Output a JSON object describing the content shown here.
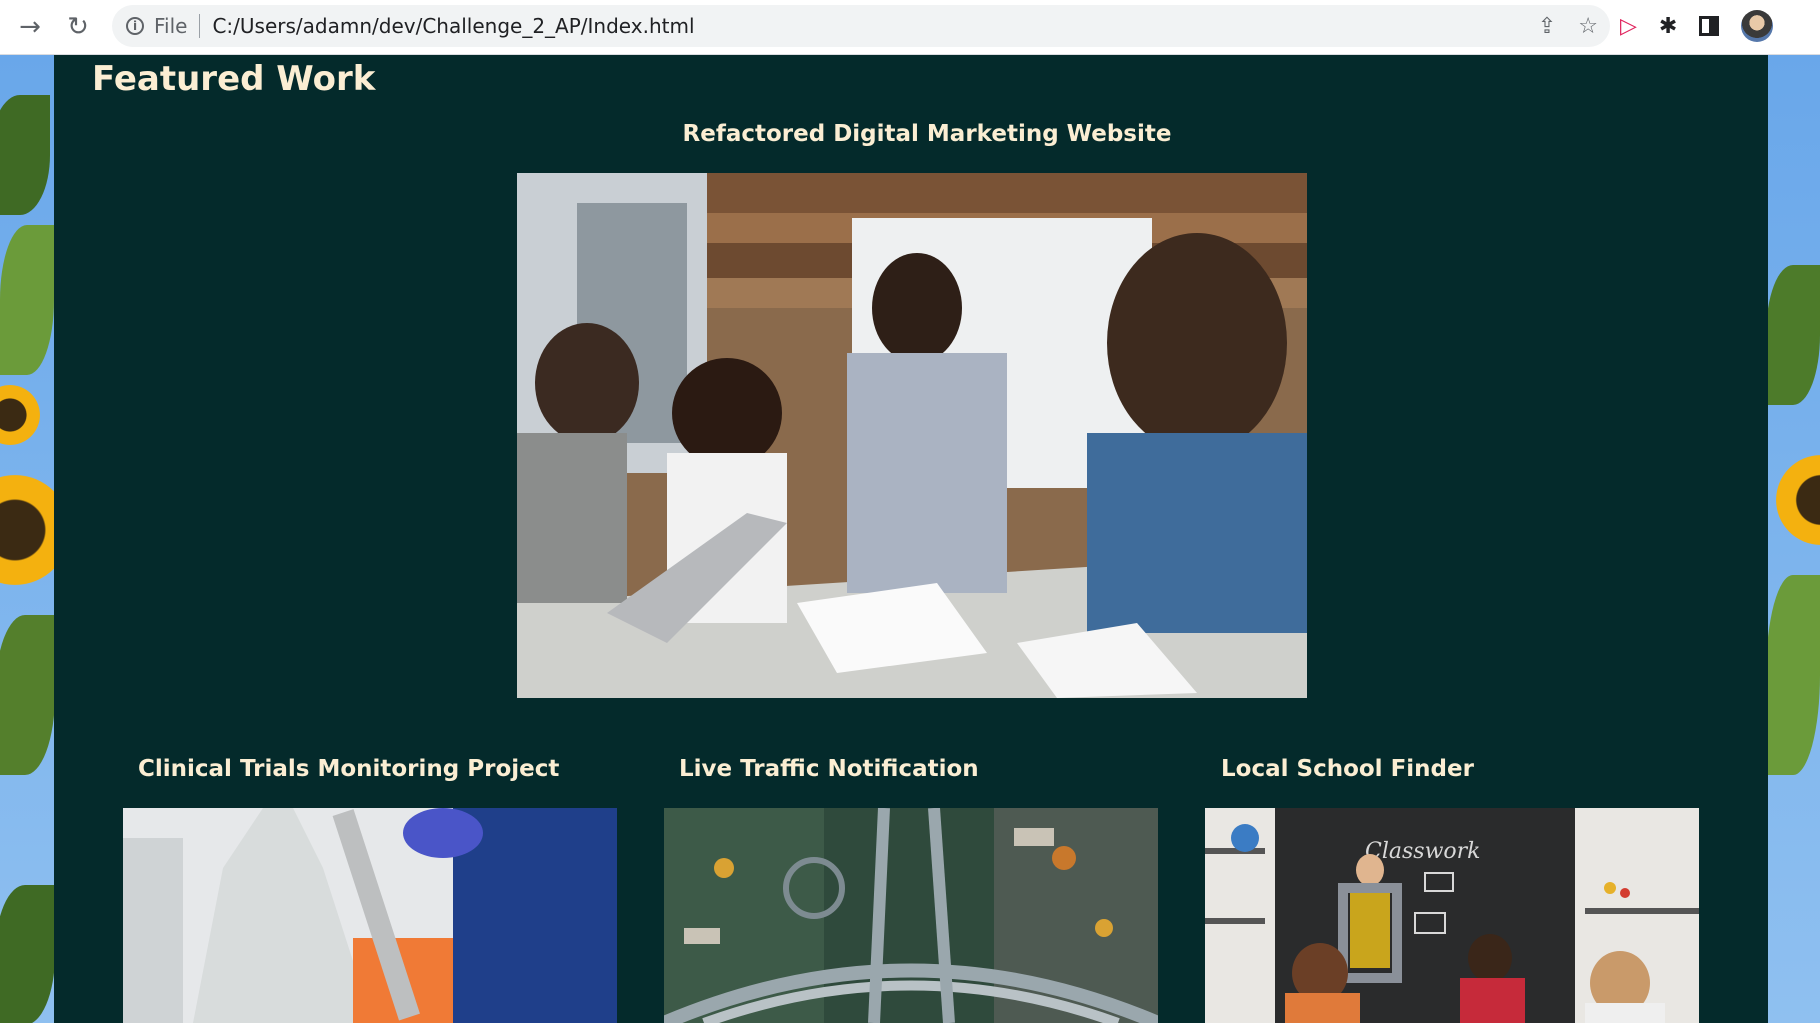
{
  "browser": {
    "url": "C:/Users/adamn/dev/Challenge_2_AP/Index.html",
    "scheme_label": "File",
    "icons": [
      "back-arrow-icon",
      "reload-icon",
      "info-icon",
      "share-icon",
      "star-icon",
      "extension-red-icon",
      "puzzle-icon",
      "side-panel-icon",
      "profile-avatar"
    ]
  },
  "page": {
    "section_title": "Featured Work",
    "featured": {
      "heading": "Refactored Digital Marketing Website",
      "image": "team-meeting-photo"
    },
    "cards": [
      {
        "heading": "Clinical Trials Monitoring Project",
        "image": "lab-pipette-photo"
      },
      {
        "heading": "Live Traffic Notification",
        "image": "aerial-highway-photo"
      },
      {
        "heading": "Local School Finder",
        "image": "classroom-photo"
      }
    ],
    "colors": {
      "panel_background": "#042a2b",
      "heading_text": "#fbeed3",
      "page_background": "#69a7ea"
    }
  }
}
